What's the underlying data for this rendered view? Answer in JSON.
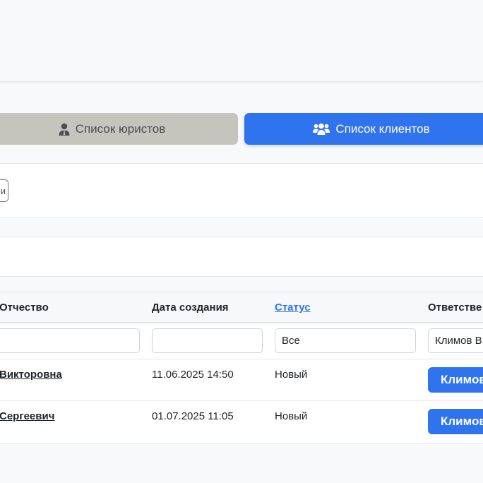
{
  "tabs": {
    "lawyers_label": "Список юристов",
    "clients_label": "Список клиентов"
  },
  "partial_button_label": "и",
  "table": {
    "headers": {
      "patronymic": "Отчество",
      "created": "Дата создания",
      "status": "Статус",
      "responsible": "Ответстве"
    },
    "filters": {
      "patronymic": "",
      "created": "",
      "status": "Все",
      "responsible": "Климов В"
    },
    "rows": [
      {
        "patronymic": "Викторовна",
        "created": "11.06.2025 14:50",
        "status": "Новый",
        "responsible": "Климов"
      },
      {
        "patronymic": "Сергеевич",
        "created": "01.07.2025 11:05",
        "status": "Новый",
        "responsible": "Климов"
      }
    ]
  },
  "colors": {
    "primary": "#2f73ee",
    "inactive_tab": "#c6c5bd"
  }
}
